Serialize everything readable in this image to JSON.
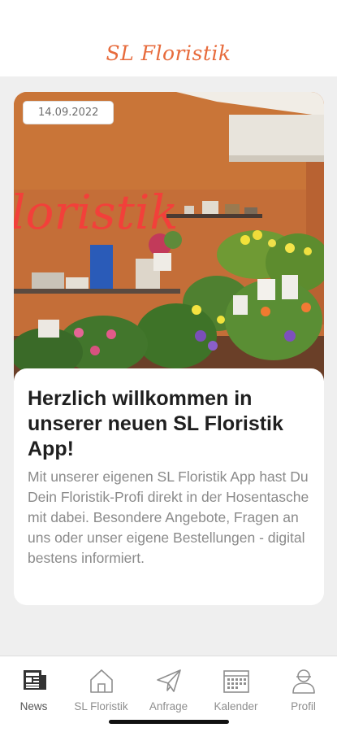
{
  "header": {
    "brand": "SL Floristik"
  },
  "post": {
    "date": "14.09.2022",
    "sign_text": "loristik",
    "title": "Herzlich willkommen in unserer neuen SL Floristik App!",
    "body": "Mit unserer eigenen SL Floristik App hast Du Dein Floristik-Profi direkt in der Hosentasche mit dabei. Besondere Angebote, Fragen an uns oder unser eigene Bestellungen - digital bestens informiert."
  },
  "nav": {
    "items": [
      {
        "label": "News",
        "icon": "newspaper-icon",
        "active": true
      },
      {
        "label": "SL Floristik",
        "icon": "house-icon",
        "active": false
      },
      {
        "label": "Anfrage",
        "icon": "paper-plane-icon",
        "active": false
      },
      {
        "label": "Kalender",
        "icon": "calendar-icon",
        "active": false
      },
      {
        "label": "Profil",
        "icon": "person-icon",
        "active": false
      }
    ]
  },
  "colors": {
    "brand": "#e76b3c",
    "wall": "#c8713a",
    "neon_sign": "#f2403a",
    "background": "#efefef"
  }
}
